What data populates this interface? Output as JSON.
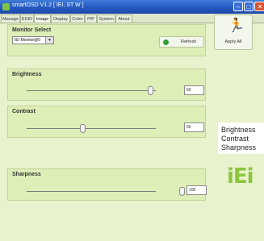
{
  "window": {
    "title": "smartOSD V1.2 [ IEI, ST W ]",
    "minimize_glyph": "–",
    "maximize_glyph": "□",
    "close_glyph": "✕"
  },
  "tabs": [
    "Manage",
    "EDID",
    "Image",
    "Display",
    "Color",
    "PIP",
    "System",
    "About"
  ],
  "active_tab": "Image",
  "monitor_select": {
    "label": "Monitor Select",
    "selected": "IEI Monitor@0",
    "refresh_label": "Refresh",
    "apply_all_label": "Apply All"
  },
  "brightness": {
    "label": "Brightness",
    "value": "60",
    "level": 0.6
  },
  "contrast": {
    "label": "Contrast",
    "value": "50",
    "level": 0.5
  },
  "sharpness": {
    "label": "Sharpness",
    "value": "100",
    "level": 1.0
  },
  "side_labels": [
    "Brightness",
    "Contrast",
    "Sharpness"
  ],
  "logo_text": "iEi",
  "icons": {
    "app": "app-icon",
    "refresh": "refresh-icon",
    "apply_all": "running-man-icon",
    "dropdown": "chevron-down-icon"
  },
  "colors": {
    "title_bar": "#2459c0",
    "window_bg": "#e8f2cc",
    "panel_bg": "#ddeeb6",
    "accent_green": "#2f9e3a",
    "logo_green": "#8cc63f"
  }
}
